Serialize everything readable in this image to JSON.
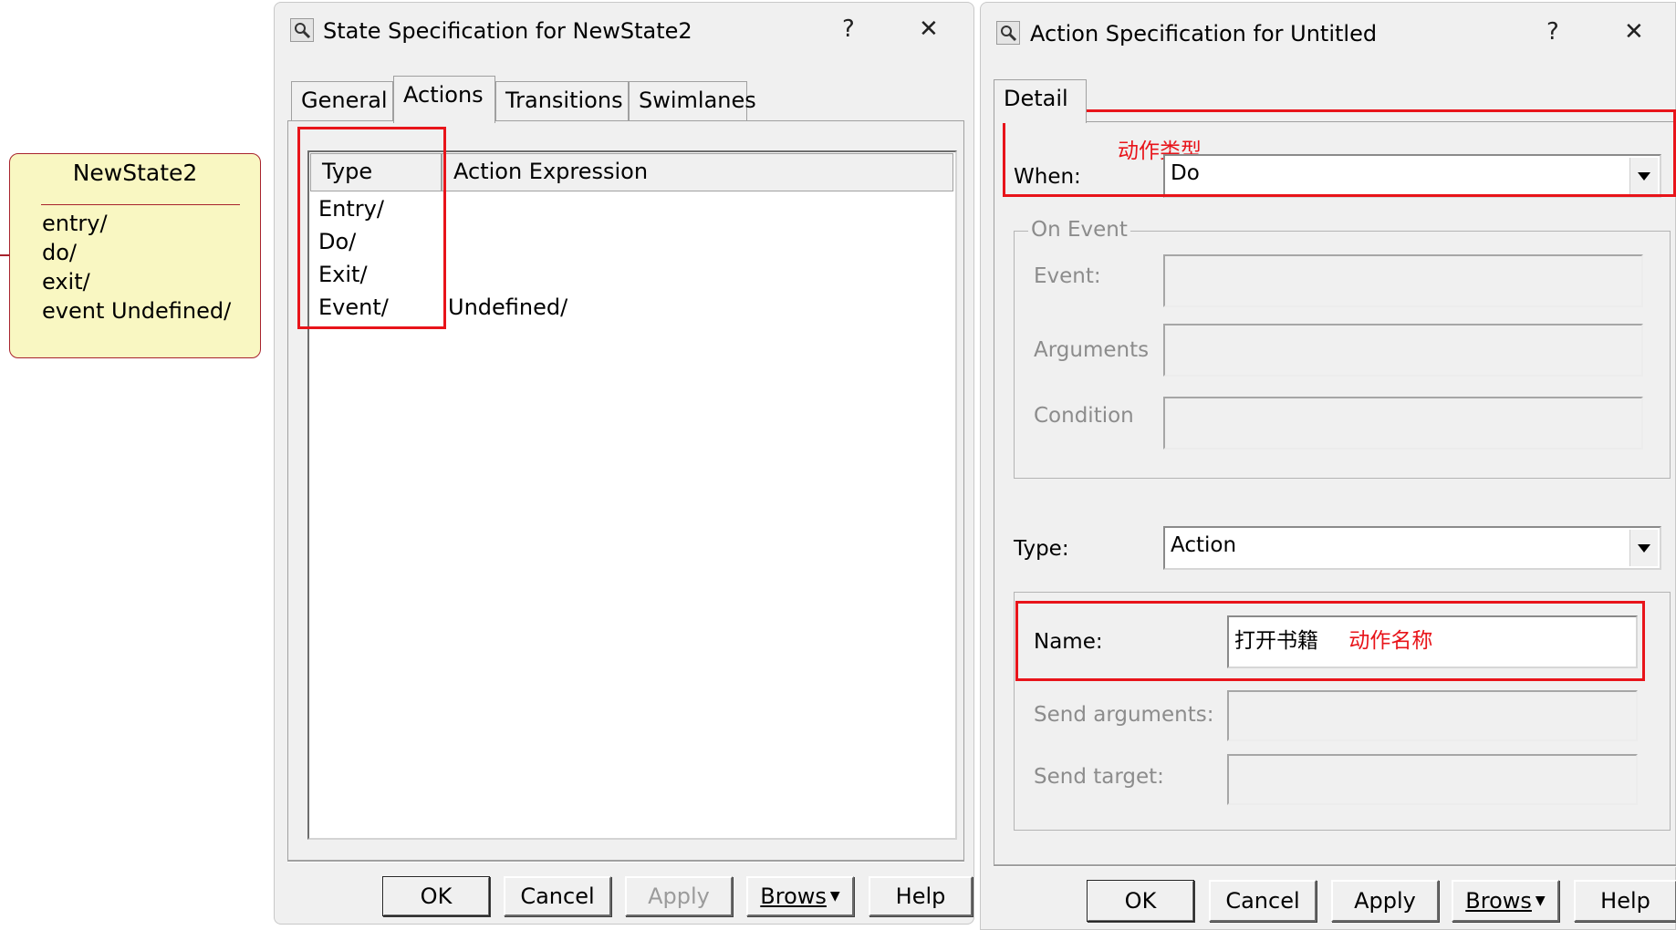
{
  "state_node": {
    "name": "NewState2",
    "lines": [
      "entry/",
      "do/",
      "exit/",
      "event Undefined/"
    ]
  },
  "state_dialog": {
    "title": "State Specification for NewState2",
    "help_glyph": "?",
    "close_glyph": "✕",
    "icon": "magnifier-icon",
    "tabs": [
      "General",
      "Actions",
      "Transitions",
      "Swimlanes"
    ],
    "active_tab": "Actions",
    "columns": [
      "Type",
      "Action Expression"
    ],
    "rows": [
      {
        "type": "Entry/",
        "expression": ""
      },
      {
        "type": "Do/",
        "expression": ""
      },
      {
        "type": "Exit/",
        "expression": ""
      },
      {
        "type": "Event/",
        "expression": "Undefined/"
      }
    ],
    "buttons": {
      "ok": "OK",
      "cancel": "Cancel",
      "apply": "Apply",
      "browse": "Brows",
      "help": "Help"
    }
  },
  "action_dialog": {
    "title": "Action Specification for Untitled",
    "help_glyph": "?",
    "close_glyph": "✕",
    "icon": "magnifier-icon",
    "tab": "Detail",
    "annotation_type": "动作类型",
    "when_label": "When:",
    "when_value": "Do",
    "on_event": {
      "title": "On Event",
      "event_label": "Event:",
      "arguments_label": "Arguments",
      "condition_label": "Condition"
    },
    "type_label": "Type:",
    "type_value": "Action",
    "name_label": "Name:",
    "name_value": "打开书籍",
    "annotation_name": "动作名称",
    "send_arguments_label": "Send arguments:",
    "send_target_label": "Send target:",
    "buttons": {
      "ok": "OK",
      "cancel": "Cancel",
      "apply": "Apply",
      "browse": "Brows",
      "help": "Help"
    }
  },
  "colors": {
    "annotation_red": "#e8141a",
    "state_fill": "#f9f7c2",
    "state_border": "#a8232d",
    "dialog_bg": "#f0f0f0"
  }
}
